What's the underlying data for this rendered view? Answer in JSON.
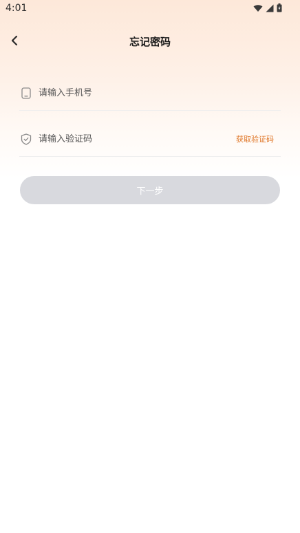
{
  "status_bar": {
    "time": "4:01",
    "icons": [
      "wifi-icon",
      "signal-icon",
      "battery-icon"
    ]
  },
  "nav": {
    "back_icon": "chevron-left-icon",
    "title": "忘记密码"
  },
  "form": {
    "phone": {
      "icon": "phone-icon",
      "placeholder": "请输入手机号",
      "value": ""
    },
    "code": {
      "icon": "shield-icon",
      "placeholder": "请输入验证码",
      "value": "",
      "get_code_label": "获取验证码"
    },
    "next_label": "下一步"
  },
  "colors": {
    "accent": "#e0782a",
    "button_disabled": "#d8d9de",
    "gradient_top": "#fde8d9"
  }
}
